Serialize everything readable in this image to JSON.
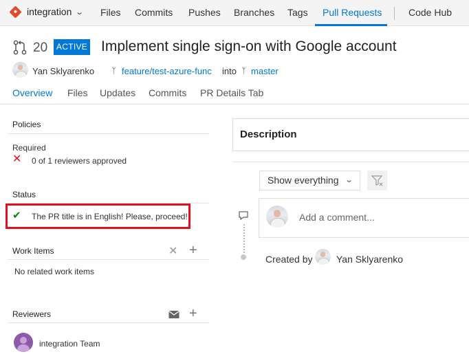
{
  "topnav": {
    "repo": "integration",
    "tabs": [
      "Files",
      "Commits",
      "Pushes",
      "Branches",
      "Tags",
      "Pull Requests"
    ],
    "active_tab": "Pull Requests",
    "extra": "Code Hub"
  },
  "pr": {
    "id": "20",
    "status": "ACTIVE",
    "title": "Implement single sign-on with Google account",
    "author": "Yan Sklyarenko",
    "source_branch": "feature/test-azure-func",
    "into": "into",
    "target_branch": "master"
  },
  "subtabs": [
    "Overview",
    "Files",
    "Updates",
    "Commits",
    "PR Details Tab"
  ],
  "left": {
    "policies": {
      "title": "Policies",
      "required": "Required",
      "reviewers_status": "0 of 1 reviewers approved"
    },
    "status": {
      "title": "Status",
      "message": "The PR title is in English! Please, proceed!"
    },
    "work_items": {
      "title": "Work Items",
      "empty": "No related work items"
    },
    "reviewers": {
      "title": "Reviewers",
      "items": [
        "integration Team"
      ]
    }
  },
  "right": {
    "description_title": "Description",
    "filter": "Show everything",
    "comment_placeholder": "Add a comment...",
    "created_by": "Created by",
    "created_by_name": "Yan Sklyarenko"
  },
  "colors": {
    "accent": "#0078d4",
    "error": "#e81123",
    "success": "#107c10",
    "highlight": "#e0101e"
  },
  "icons": [
    "git-repo-icon",
    "chevron-down-icon",
    "pull-request-icon",
    "branch-icon",
    "close-icon",
    "check-icon",
    "plus-icon",
    "mail-icon",
    "filter-icon",
    "comment-icon"
  ]
}
